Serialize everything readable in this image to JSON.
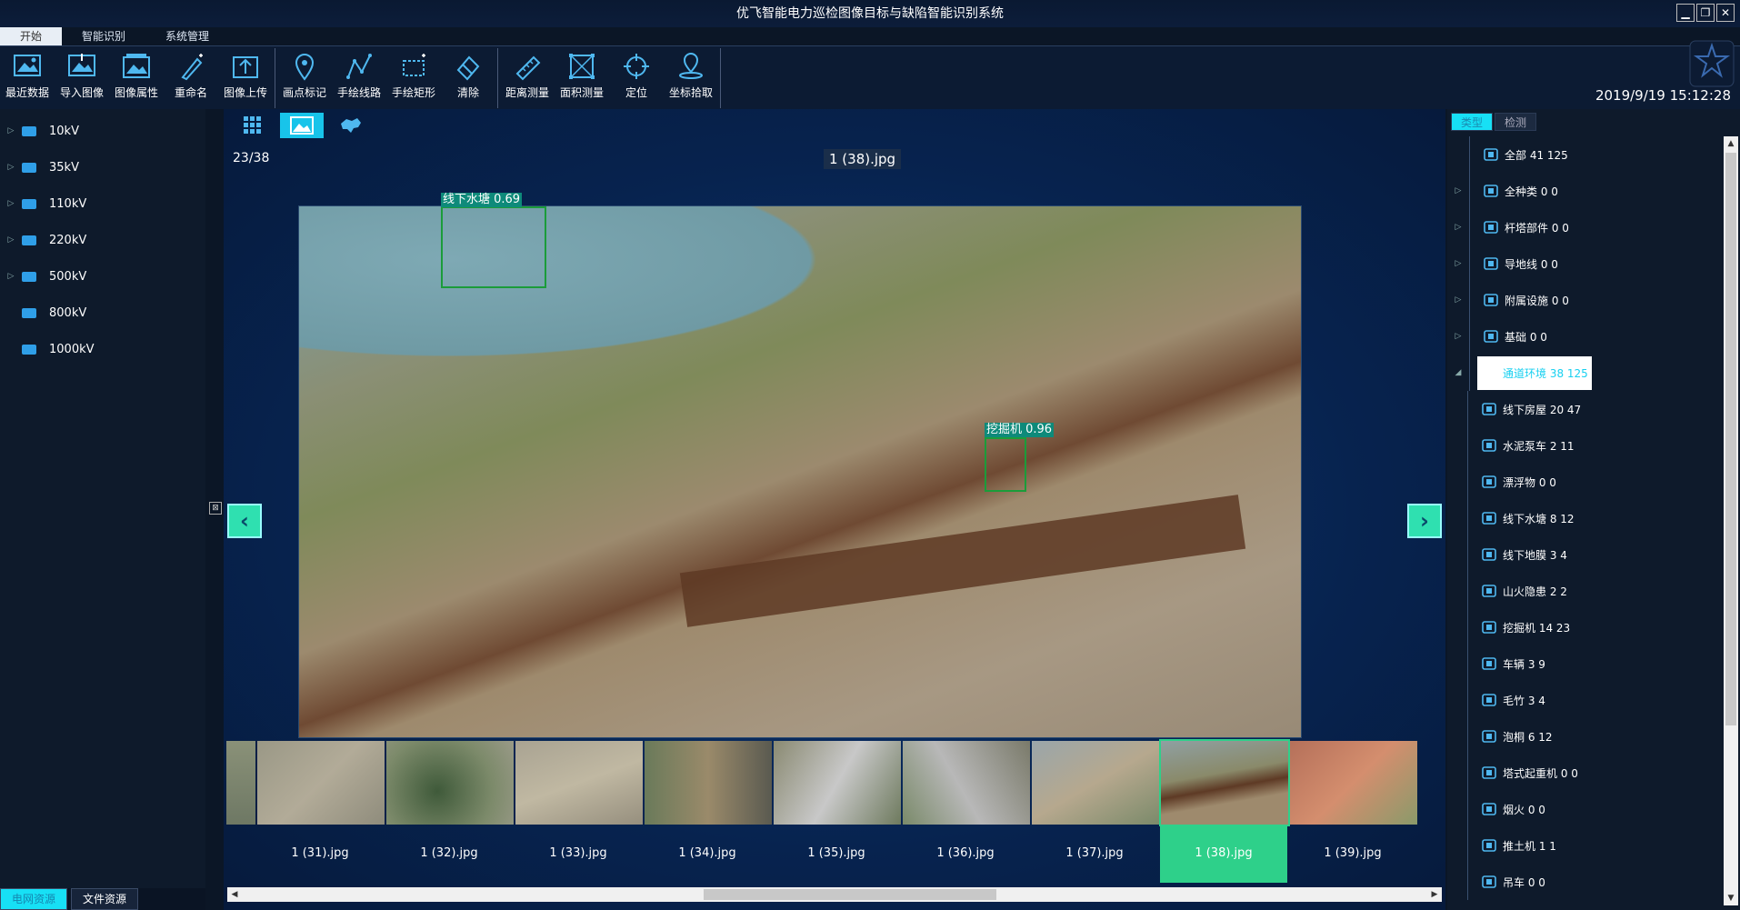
{
  "window": {
    "title": "优飞智能电力巡检图像目标与缺陷智能识别系统",
    "controls": [
      "▁",
      "❐",
      "✕"
    ]
  },
  "menu_tabs": [
    {
      "label": "开始",
      "active": true
    },
    {
      "label": "智能识别",
      "active": false
    },
    {
      "label": "系统管理",
      "active": false
    }
  ],
  "toolbar": {
    "group1": [
      {
        "label": "最近数据",
        "icon": "recent-data-icon"
      },
      {
        "label": "导入图像",
        "icon": "import-image-icon"
      },
      {
        "label": "图像属性",
        "icon": "image-properties-icon"
      },
      {
        "label": "重命名",
        "icon": "rename-icon"
      },
      {
        "label": "图像上传",
        "icon": "upload-icon"
      }
    ],
    "group2": [
      {
        "label": "画点标记",
        "icon": "point-marker-icon"
      },
      {
        "label": "手绘线路",
        "icon": "draw-line-icon"
      },
      {
        "label": "手绘矩形",
        "icon": "draw-rect-icon"
      },
      {
        "label": "清除",
        "icon": "eraser-icon"
      }
    ],
    "group3": [
      {
        "label": "距离测量",
        "icon": "ruler-icon"
      },
      {
        "label": "面积测量",
        "icon": "area-measure-icon"
      },
      {
        "label": "定位",
        "icon": "locate-icon"
      },
      {
        "label": "坐标拾取",
        "icon": "coordinate-pick-icon"
      }
    ]
  },
  "datetime": "2019/9/19 15:12:28",
  "left_tree": [
    {
      "label": "10kV",
      "expandable": true
    },
    {
      "label": "35kV",
      "expandable": true
    },
    {
      "label": "110kV",
      "expandable": true
    },
    {
      "label": "220kV",
      "expandable": true
    },
    {
      "label": "500kV",
      "expandable": true
    },
    {
      "label": "800kV",
      "expandable": false
    },
    {
      "label": "1000kV",
      "expandable": false
    }
  ],
  "left_bottom_tabs": [
    {
      "label": "电网资源",
      "active": true
    },
    {
      "label": "文件资源",
      "active": false
    }
  ],
  "viewer": {
    "counter": "23/38",
    "filename": "1 (38).jpg",
    "detections": [
      {
        "label": "线下水塘 0.69",
        "color": "#1b9c3a"
      },
      {
        "label": "挖掘机 0.96",
        "color": "#1b9c3a"
      }
    ]
  },
  "thumbnails": [
    {
      "caption": "",
      "active": false
    },
    {
      "caption": "1 (31).jpg",
      "active": false
    },
    {
      "caption": "1 (32).jpg",
      "active": false
    },
    {
      "caption": "1 (33).jpg",
      "active": false
    },
    {
      "caption": "1 (34).jpg",
      "active": false
    },
    {
      "caption": "1 (35).jpg",
      "active": false
    },
    {
      "caption": "1 (36).jpg",
      "active": false
    },
    {
      "caption": "1 (37).jpg",
      "active": false
    },
    {
      "caption": "1 (38).jpg",
      "active": true
    },
    {
      "caption": "1 (39).jpg",
      "active": false
    }
  ],
  "right_tabs": [
    {
      "label": "类型",
      "active": true
    },
    {
      "label": "检测",
      "active": false
    }
  ],
  "right_tree": [
    {
      "label": "全部 41 125",
      "expandable": false,
      "child": false,
      "selected": false,
      "icon": "grid-icon"
    },
    {
      "label": "全种类 0 0",
      "expandable": true,
      "child": false,
      "selected": false,
      "icon": "list-icon"
    },
    {
      "label": "杆塔部件 0 0",
      "expandable": true,
      "child": false,
      "selected": false,
      "icon": "tower-part-icon"
    },
    {
      "label": "导地线 0 0",
      "expandable": true,
      "child": false,
      "selected": false,
      "icon": "wire-icon"
    },
    {
      "label": "附属设施 0 0",
      "expandable": true,
      "child": false,
      "selected": false,
      "icon": "facility-icon"
    },
    {
      "label": "基础 0 0",
      "expandable": true,
      "child": false,
      "selected": false,
      "icon": "foundation-icon"
    },
    {
      "label": "通道环境 38 125",
      "expandable": true,
      "child": false,
      "selected": true,
      "icon": "channel-env-icon"
    },
    {
      "label": "线下房屋 20 47",
      "expandable": false,
      "child": true,
      "selected": false,
      "icon": "house-icon"
    },
    {
      "label": "水泥泵车 2 11",
      "expandable": false,
      "child": true,
      "selected": false,
      "icon": "pump-truck-icon"
    },
    {
      "label": "漂浮物 0 0",
      "expandable": false,
      "child": true,
      "selected": false,
      "icon": "floating-object-icon"
    },
    {
      "label": "线下水塘 8 12",
      "expandable": false,
      "child": true,
      "selected": false,
      "icon": "pond-icon"
    },
    {
      "label": "线下地膜 3 4",
      "expandable": false,
      "child": true,
      "selected": false,
      "icon": "film-icon"
    },
    {
      "label": "山火隐患 2 2",
      "expandable": false,
      "child": true,
      "selected": false,
      "icon": "fire-icon"
    },
    {
      "label": "挖掘机 14 23",
      "expandable": false,
      "child": true,
      "selected": false,
      "icon": "excavator-icon"
    },
    {
      "label": "车辆 3 9",
      "expandable": false,
      "child": true,
      "selected": false,
      "icon": "vehicle-icon"
    },
    {
      "label": "毛竹 3 4",
      "expandable": false,
      "child": true,
      "selected": false,
      "icon": "bamboo-icon"
    },
    {
      "label": "泡桐 6 12",
      "expandable": false,
      "child": true,
      "selected": false,
      "icon": "tree-icon"
    },
    {
      "label": "塔式起重机 0 0",
      "expandable": false,
      "child": true,
      "selected": false,
      "icon": "tower-crane-icon"
    },
    {
      "label": "烟火 0 0",
      "expandable": false,
      "child": true,
      "selected": false,
      "icon": "smoke-fire-icon"
    },
    {
      "label": "推土机 1 1",
      "expandable": false,
      "child": true,
      "selected": false,
      "icon": "bulldozer-icon"
    },
    {
      "label": "吊车 0 0",
      "expandable": false,
      "child": true,
      "selected": false,
      "icon": "crane-icon"
    }
  ],
  "colors": {
    "accent": "#17e0f5",
    "active_thumb": "#2ed08a",
    "bbox": "#1b9c3a",
    "folder": "#2f9fe8"
  }
}
